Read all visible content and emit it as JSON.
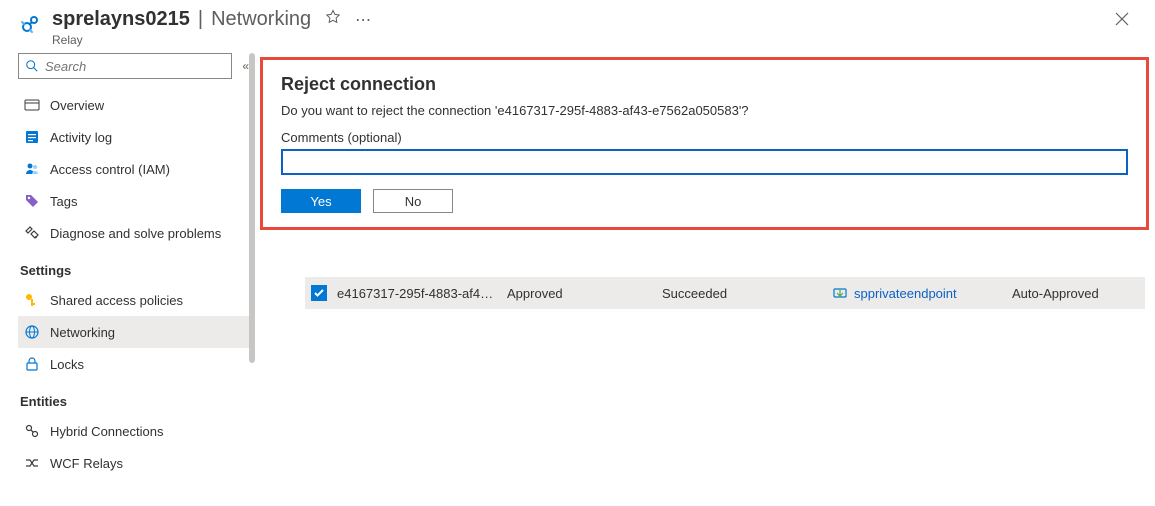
{
  "header": {
    "resource_name": "sprelayns0215",
    "blade_name": "Networking",
    "resource_type": "Relay"
  },
  "search": {
    "placeholder": "Search"
  },
  "nav": {
    "items": [
      {
        "label": "Overview"
      },
      {
        "label": "Activity log"
      },
      {
        "label": "Access control (IAM)"
      },
      {
        "label": "Tags"
      },
      {
        "label": "Diagnose and solve problems"
      }
    ],
    "settings_header": "Settings",
    "settings": [
      {
        "label": "Shared access policies"
      },
      {
        "label": "Networking"
      },
      {
        "label": "Locks"
      }
    ],
    "entities_header": "Entities",
    "entities": [
      {
        "label": "Hybrid Connections"
      },
      {
        "label": "WCF Relays"
      }
    ]
  },
  "dialog": {
    "title": "Reject connection",
    "message": "Do you want to reject the connection 'e4167317-295f-4883-af43-e7562a050583'?",
    "comments_label": "Comments (optional)",
    "comments_value": "",
    "yes": "Yes",
    "no": "No"
  },
  "row": {
    "name": "e4167317-295f-4883-af4…",
    "conn_state": "Approved",
    "prov_state": "Succeeded",
    "endpoint": "spprivateendpoint",
    "description": "Auto-Approved"
  }
}
